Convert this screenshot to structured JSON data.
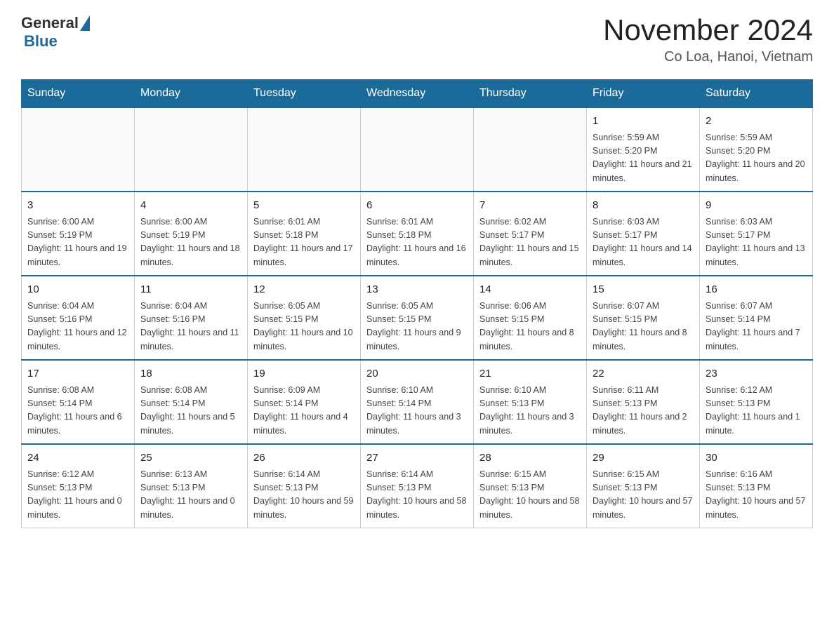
{
  "header": {
    "logo_general": "General",
    "logo_blue": "Blue",
    "title": "November 2024",
    "subtitle": "Co Loa, Hanoi, Vietnam"
  },
  "weekdays": [
    "Sunday",
    "Monday",
    "Tuesday",
    "Wednesday",
    "Thursday",
    "Friday",
    "Saturday"
  ],
  "weeks": [
    [
      {
        "day": "",
        "sunrise": "",
        "sunset": "",
        "daylight": ""
      },
      {
        "day": "",
        "sunrise": "",
        "sunset": "",
        "daylight": ""
      },
      {
        "day": "",
        "sunrise": "",
        "sunset": "",
        "daylight": ""
      },
      {
        "day": "",
        "sunrise": "",
        "sunset": "",
        "daylight": ""
      },
      {
        "day": "",
        "sunrise": "",
        "sunset": "",
        "daylight": ""
      },
      {
        "day": "1",
        "sunrise": "Sunrise: 5:59 AM",
        "sunset": "Sunset: 5:20 PM",
        "daylight": "Daylight: 11 hours and 21 minutes."
      },
      {
        "day": "2",
        "sunrise": "Sunrise: 5:59 AM",
        "sunset": "Sunset: 5:20 PM",
        "daylight": "Daylight: 11 hours and 20 minutes."
      }
    ],
    [
      {
        "day": "3",
        "sunrise": "Sunrise: 6:00 AM",
        "sunset": "Sunset: 5:19 PM",
        "daylight": "Daylight: 11 hours and 19 minutes."
      },
      {
        "day": "4",
        "sunrise": "Sunrise: 6:00 AM",
        "sunset": "Sunset: 5:19 PM",
        "daylight": "Daylight: 11 hours and 18 minutes."
      },
      {
        "day": "5",
        "sunrise": "Sunrise: 6:01 AM",
        "sunset": "Sunset: 5:18 PM",
        "daylight": "Daylight: 11 hours and 17 minutes."
      },
      {
        "day": "6",
        "sunrise": "Sunrise: 6:01 AM",
        "sunset": "Sunset: 5:18 PM",
        "daylight": "Daylight: 11 hours and 16 minutes."
      },
      {
        "day": "7",
        "sunrise": "Sunrise: 6:02 AM",
        "sunset": "Sunset: 5:17 PM",
        "daylight": "Daylight: 11 hours and 15 minutes."
      },
      {
        "day": "8",
        "sunrise": "Sunrise: 6:03 AM",
        "sunset": "Sunset: 5:17 PM",
        "daylight": "Daylight: 11 hours and 14 minutes."
      },
      {
        "day": "9",
        "sunrise": "Sunrise: 6:03 AM",
        "sunset": "Sunset: 5:17 PM",
        "daylight": "Daylight: 11 hours and 13 minutes."
      }
    ],
    [
      {
        "day": "10",
        "sunrise": "Sunrise: 6:04 AM",
        "sunset": "Sunset: 5:16 PM",
        "daylight": "Daylight: 11 hours and 12 minutes."
      },
      {
        "day": "11",
        "sunrise": "Sunrise: 6:04 AM",
        "sunset": "Sunset: 5:16 PM",
        "daylight": "Daylight: 11 hours and 11 minutes."
      },
      {
        "day": "12",
        "sunrise": "Sunrise: 6:05 AM",
        "sunset": "Sunset: 5:15 PM",
        "daylight": "Daylight: 11 hours and 10 minutes."
      },
      {
        "day": "13",
        "sunrise": "Sunrise: 6:05 AM",
        "sunset": "Sunset: 5:15 PM",
        "daylight": "Daylight: 11 hours and 9 minutes."
      },
      {
        "day": "14",
        "sunrise": "Sunrise: 6:06 AM",
        "sunset": "Sunset: 5:15 PM",
        "daylight": "Daylight: 11 hours and 8 minutes."
      },
      {
        "day": "15",
        "sunrise": "Sunrise: 6:07 AM",
        "sunset": "Sunset: 5:15 PM",
        "daylight": "Daylight: 11 hours and 8 minutes."
      },
      {
        "day": "16",
        "sunrise": "Sunrise: 6:07 AM",
        "sunset": "Sunset: 5:14 PM",
        "daylight": "Daylight: 11 hours and 7 minutes."
      }
    ],
    [
      {
        "day": "17",
        "sunrise": "Sunrise: 6:08 AM",
        "sunset": "Sunset: 5:14 PM",
        "daylight": "Daylight: 11 hours and 6 minutes."
      },
      {
        "day": "18",
        "sunrise": "Sunrise: 6:08 AM",
        "sunset": "Sunset: 5:14 PM",
        "daylight": "Daylight: 11 hours and 5 minutes."
      },
      {
        "day": "19",
        "sunrise": "Sunrise: 6:09 AM",
        "sunset": "Sunset: 5:14 PM",
        "daylight": "Daylight: 11 hours and 4 minutes."
      },
      {
        "day": "20",
        "sunrise": "Sunrise: 6:10 AM",
        "sunset": "Sunset: 5:14 PM",
        "daylight": "Daylight: 11 hours and 3 minutes."
      },
      {
        "day": "21",
        "sunrise": "Sunrise: 6:10 AM",
        "sunset": "Sunset: 5:13 PM",
        "daylight": "Daylight: 11 hours and 3 minutes."
      },
      {
        "day": "22",
        "sunrise": "Sunrise: 6:11 AM",
        "sunset": "Sunset: 5:13 PM",
        "daylight": "Daylight: 11 hours and 2 minutes."
      },
      {
        "day": "23",
        "sunrise": "Sunrise: 6:12 AM",
        "sunset": "Sunset: 5:13 PM",
        "daylight": "Daylight: 11 hours and 1 minute."
      }
    ],
    [
      {
        "day": "24",
        "sunrise": "Sunrise: 6:12 AM",
        "sunset": "Sunset: 5:13 PM",
        "daylight": "Daylight: 11 hours and 0 minutes."
      },
      {
        "day": "25",
        "sunrise": "Sunrise: 6:13 AM",
        "sunset": "Sunset: 5:13 PM",
        "daylight": "Daylight: 11 hours and 0 minutes."
      },
      {
        "day": "26",
        "sunrise": "Sunrise: 6:14 AM",
        "sunset": "Sunset: 5:13 PM",
        "daylight": "Daylight: 10 hours and 59 minutes."
      },
      {
        "day": "27",
        "sunrise": "Sunrise: 6:14 AM",
        "sunset": "Sunset: 5:13 PM",
        "daylight": "Daylight: 10 hours and 58 minutes."
      },
      {
        "day": "28",
        "sunrise": "Sunrise: 6:15 AM",
        "sunset": "Sunset: 5:13 PM",
        "daylight": "Daylight: 10 hours and 58 minutes."
      },
      {
        "day": "29",
        "sunrise": "Sunrise: 6:15 AM",
        "sunset": "Sunset: 5:13 PM",
        "daylight": "Daylight: 10 hours and 57 minutes."
      },
      {
        "day": "30",
        "sunrise": "Sunrise: 6:16 AM",
        "sunset": "Sunset: 5:13 PM",
        "daylight": "Daylight: 10 hours and 57 minutes."
      }
    ]
  ]
}
